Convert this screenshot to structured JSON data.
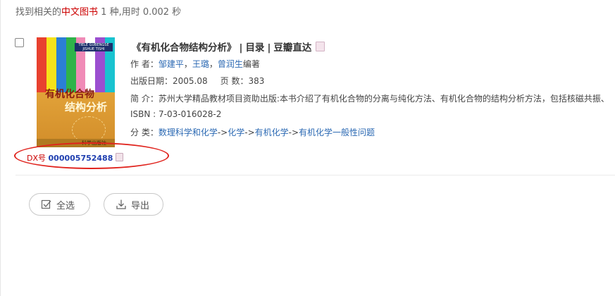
{
  "summary": {
    "prefix": "找到相关的",
    "highlight": "中文图书",
    "stats": " 1 种,用时 0.002 秒"
  },
  "book": {
    "title": "《有机化合物结构分析》",
    "links": {
      "toc": "目录",
      "douban": "豆瓣直达"
    },
    "author_label": "作 者：",
    "authors": [
      "邹建平",
      "王璐",
      "曾润生"
    ],
    "author_role": "编著",
    "date_label": "出版日期：",
    "date": "2005.08",
    "pages_label": "页 数：",
    "pages": "383",
    "intro_label": "简 介：",
    "intro": "苏州大学精品教材项目资助出版:本书介绍了有机化合物的分离与纯化方法、有机化合物的结构分析方法，包括核磁共振、",
    "isbn": "ISBN : 7-03-016028-2",
    "category_label": "分 类：",
    "categories": [
      "数理科学和化学",
      "化学",
      "有机化学",
      "有机化学一般性问题"
    ],
    "category_sep": "->",
    "dx_label": "DX号",
    "dx_number": "000005752488",
    "cover": {
      "band": "TIELE GUBENGSE JISHUE TISHI",
      "title_line1": "有机化合物",
      "title_line2": "结构分析",
      "publisher": "科学出版社"
    }
  },
  "actions": {
    "select_all": "全选",
    "export": "导出"
  },
  "colors": {
    "highlight": "#cc0000",
    "link": "#2b69b3",
    "dx_number": "#1f3fb0",
    "annotation": "#e0231d"
  }
}
